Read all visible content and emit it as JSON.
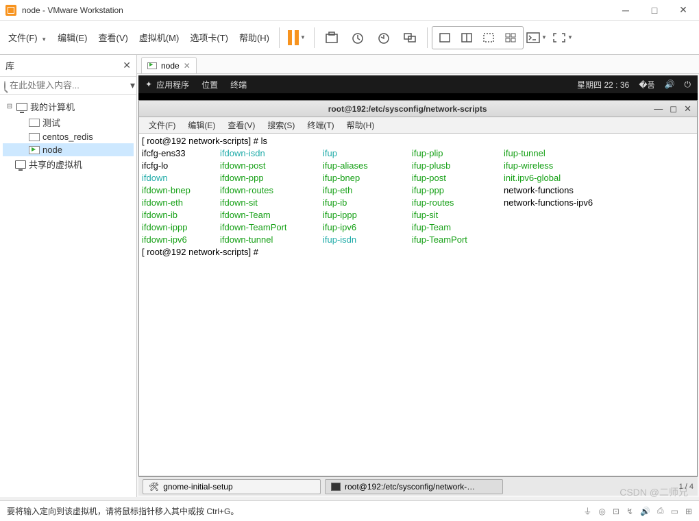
{
  "titlebar": {
    "title": "node - VMware Workstation"
  },
  "menus": {
    "file": "文件(F)",
    "edit": "编辑(E)",
    "view": "查看(V)",
    "vm": "虚拟机(M)",
    "tabs": "选项卡(T)",
    "help": "帮助(H)"
  },
  "sidebar": {
    "header": "库",
    "search_placeholder": "在此处键入内容...",
    "root": "我的计算机",
    "items": [
      "测试",
      "centos_redis",
      "node"
    ],
    "shared": "共享的虚拟机"
  },
  "tab": {
    "label": "node"
  },
  "gnome": {
    "apps": "应用程序",
    "places": "位置",
    "terminal": "终端",
    "clock": "星期四 22 : 36"
  },
  "term": {
    "title": "root@192:/etc/sysconfig/network-scripts",
    "menus": {
      "file": "文件(F)",
      "edit": "编辑(E)",
      "view": "查看(V)",
      "search": "搜索(S)",
      "terminal": "终端(T)",
      "help": "帮助(H)"
    },
    "prompt1_a": "[ root@192 network-scripts] # ",
    "cmd1": "ls",
    "prompt2": "[ root@192 network-scripts] # ",
    "cols": {
      "c1": [
        {
          "t": "ifcfg-ens33",
          "c": ""
        },
        {
          "t": "ifcfg-lo",
          "c": ""
        },
        {
          "t": "ifdown",
          "c": "c-c"
        },
        {
          "t": "ifdown-bnep",
          "c": "c-g"
        },
        {
          "t": "ifdown-eth",
          "c": "c-g"
        },
        {
          "t": "ifdown-ib",
          "c": "c-g"
        },
        {
          "t": "ifdown-ippp",
          "c": "c-g"
        },
        {
          "t": "ifdown-ipv6",
          "c": "c-g"
        }
      ],
      "c2": [
        {
          "t": "ifdown-isdn",
          "c": "c-c"
        },
        {
          "t": "ifdown-post",
          "c": "c-g"
        },
        {
          "t": "ifdown-ppp",
          "c": "c-g"
        },
        {
          "t": "ifdown-routes",
          "c": "c-g"
        },
        {
          "t": "ifdown-sit",
          "c": "c-g"
        },
        {
          "t": "ifdown-Team",
          "c": "c-g"
        },
        {
          "t": "ifdown-TeamPort",
          "c": "c-g"
        },
        {
          "t": "ifdown-tunnel",
          "c": "c-g"
        }
      ],
      "c3": [
        {
          "t": "ifup",
          "c": "c-c"
        },
        {
          "t": "ifup-aliases",
          "c": "c-g"
        },
        {
          "t": "ifup-bnep",
          "c": "c-g"
        },
        {
          "t": "ifup-eth",
          "c": "c-g"
        },
        {
          "t": "ifup-ib",
          "c": "c-g"
        },
        {
          "t": "ifup-ippp",
          "c": "c-g"
        },
        {
          "t": "ifup-ipv6",
          "c": "c-g"
        },
        {
          "t": "ifup-isdn",
          "c": "c-c"
        }
      ],
      "c4": [
        {
          "t": "ifup-plip",
          "c": "c-g"
        },
        {
          "t": "ifup-plusb",
          "c": "c-g"
        },
        {
          "t": "ifup-post",
          "c": "c-g"
        },
        {
          "t": "ifup-ppp",
          "c": "c-g"
        },
        {
          "t": "ifup-routes",
          "c": "c-g"
        },
        {
          "t": "ifup-sit",
          "c": "c-g"
        },
        {
          "t": "ifup-Team",
          "c": "c-g"
        },
        {
          "t": "ifup-TeamPort",
          "c": "c-g"
        }
      ],
      "c5": [
        {
          "t": "ifup-tunnel",
          "c": "c-g"
        },
        {
          "t": "ifup-wireless",
          "c": "c-g"
        },
        {
          "t": "init.ipv6-global",
          "c": "c-g"
        },
        {
          "t": "network-functions",
          "c": ""
        },
        {
          "t": "network-functions-ipv6",
          "c": ""
        }
      ]
    }
  },
  "taskbar": {
    "task1": "gnome-initial-setup",
    "task2": "root@192:/etc/sysconfig/network-…",
    "workspace": "1 / 4"
  },
  "status": {
    "hint": "要将输入定向到该虚拟机，请将鼠标指针移入其中或按 Ctrl+G。"
  },
  "watermark": "CSDN @二师兄"
}
